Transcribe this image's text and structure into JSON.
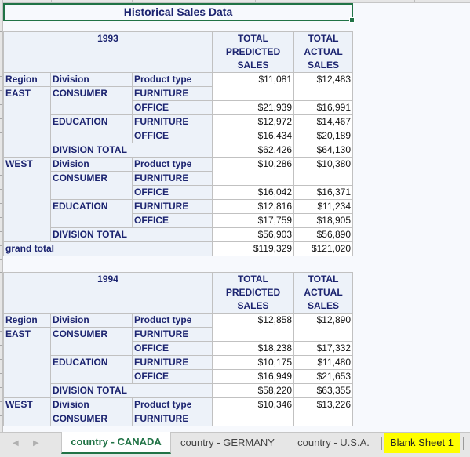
{
  "title": "Historical Sales Data",
  "column_headers": {
    "region": "Region",
    "division": "Division",
    "product_type": "Product type",
    "predicted": [
      "TOTAL",
      "PREDICTED",
      "SALES"
    ],
    "actual": [
      "TOTAL",
      "ACTUAL",
      "SALES"
    ]
  },
  "labels": {
    "division_total": "DIVISION TOTAL",
    "grand_total": "grand total"
  },
  "blocks": [
    {
      "year": "1993",
      "regions": [
        {
          "name": "EAST",
          "rows": [
            {
              "division": "CONSUMER",
              "product": "FURNITURE",
              "predicted": "$11,081",
              "actual": "$12,483"
            },
            {
              "division": "",
              "product": "OFFICE",
              "predicted": "$21,939",
              "actual": "$16,991"
            },
            {
              "division": "EDUCATION",
              "product": "FURNITURE",
              "predicted": "$12,972",
              "actual": "$14,467"
            },
            {
              "division": "",
              "product": "OFFICE",
              "predicted": "$16,434",
              "actual": "$20,189"
            }
          ],
          "total": {
            "predicted": "$62,426",
            "actual": "$64,130"
          }
        },
        {
          "name": "WEST",
          "rows": [
            {
              "division": "CONSUMER",
              "product": "FURNITURE",
              "predicted": "$10,286",
              "actual": "$10,380"
            },
            {
              "division": "",
              "product": "OFFICE",
              "predicted": "$16,042",
              "actual": "$16,371"
            },
            {
              "division": "EDUCATION",
              "product": "FURNITURE",
              "predicted": "$12,816",
              "actual": "$11,234"
            },
            {
              "division": "",
              "product": "OFFICE",
              "predicted": "$17,759",
              "actual": "$18,905"
            }
          ],
          "total": {
            "predicted": "$56,903",
            "actual": "$56,890"
          }
        }
      ],
      "grand_total": {
        "predicted": "$119,329",
        "actual": "$121,020"
      }
    },
    {
      "year": "1994",
      "regions": [
        {
          "name": "EAST",
          "rows": [
            {
              "division": "CONSUMER",
              "product": "FURNITURE",
              "predicted": "$12,858",
              "actual": "$12,890"
            },
            {
              "division": "",
              "product": "OFFICE",
              "predicted": "$18,238",
              "actual": "$17,332"
            },
            {
              "division": "EDUCATION",
              "product": "FURNITURE",
              "predicted": "$10,175",
              "actual": "$11,480"
            },
            {
              "division": "",
              "product": "OFFICE",
              "predicted": "$16,949",
              "actual": "$21,653"
            }
          ],
          "total": {
            "predicted": "$58,220",
            "actual": "$63,355"
          }
        },
        {
          "name": "WEST",
          "rows": [
            {
              "division": "CONSUMER",
              "product": "FURNITURE",
              "predicted": "$10,346",
              "actual": "$13,226"
            }
          ]
        }
      ]
    }
  ],
  "tabs": [
    {
      "label": "country - CANADA",
      "active": true
    },
    {
      "label": "country - GERMANY",
      "active": false
    },
    {
      "label": "country - U.S.A.",
      "active": false
    },
    {
      "label": "Blank Sheet 1",
      "active": false,
      "highlight": "#ffff00"
    }
  ],
  "nav": {
    "prev_icon": "◀",
    "next_icon": "▶"
  },
  "colors": {
    "accent": "#217346",
    "header_text": "#1c2470",
    "header_bg": "#edf2f9"
  }
}
